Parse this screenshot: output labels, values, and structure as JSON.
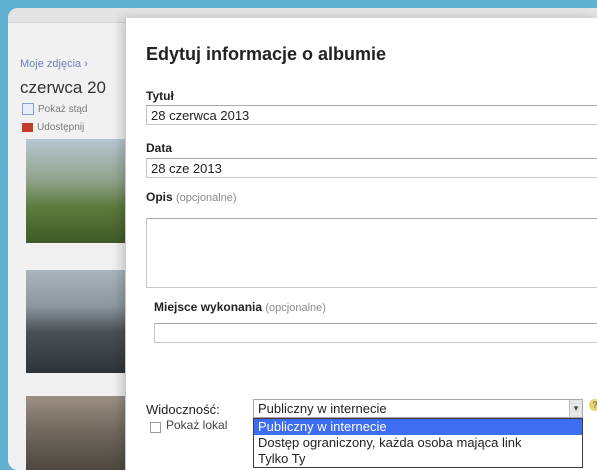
{
  "background": {
    "breadcrumb": "Moje zdjęcia ›",
    "album_title": "czerwca 20",
    "actions": [
      {
        "label": "Pokaż stąd",
        "icon": "slideshow-icon"
      },
      {
        "label": "Udostępnij",
        "icon": "share-icon"
      }
    ]
  },
  "dialog": {
    "title": "Edytuj informacje o albumie",
    "title_field": {
      "label": "Tytuł",
      "value": "28 czerwca 2013"
    },
    "date_field": {
      "label": "Data",
      "value": "28 cze 2013"
    },
    "description_field": {
      "label": "Opis",
      "optional": "(opcjonalne)",
      "value": ""
    },
    "location_field": {
      "label": "Miejsce wykonania",
      "optional": "(opcjonalne)",
      "value": ""
    },
    "visibility": {
      "label": "Widoczność:",
      "selected": "Publiczny w internecie",
      "options": [
        "Publiczny w internecie",
        "Dostęp ograniczony, każda osoba mająca link",
        "Tylko Ty"
      ],
      "help": "?"
    },
    "show_location_checkbox": {
      "label": "Pokaż lokal",
      "checked": false
    }
  },
  "colors": {
    "frame_background": "#5fb1cf",
    "dropdown_highlight": "#3d6ef2"
  }
}
